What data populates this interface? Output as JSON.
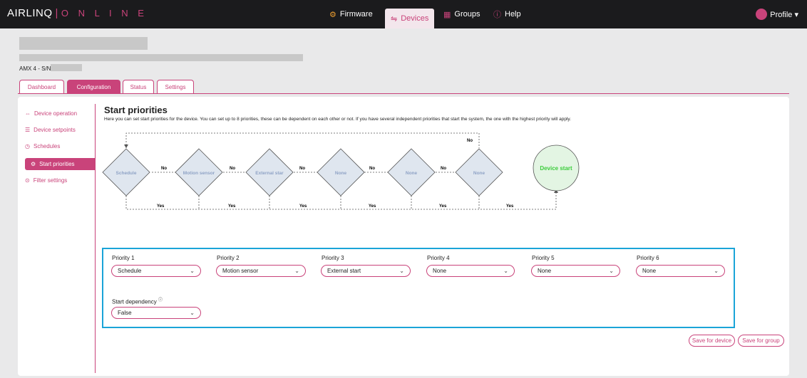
{
  "brand": {
    "name": "AIRLINQ",
    "separator": "|",
    "sub": "O N L I N E"
  },
  "nav": {
    "firmware": "Firmware",
    "devices": "Devices",
    "groups": "Groups",
    "help": "Help"
  },
  "profile": {
    "label": "Profile ▾"
  },
  "device": {
    "serial_label": "AMX 4 - S/N:"
  },
  "tabs": [
    "Dashboard",
    "Configuration",
    "Status",
    "Settings"
  ],
  "sidebar": {
    "items": [
      {
        "icon": "⇔",
        "label": "Device operation"
      },
      {
        "icon": "☰",
        "label": "Device setpoints"
      },
      {
        "icon": "◷",
        "label": "Schedules"
      },
      {
        "icon": "⚙",
        "label": "Start priorities"
      },
      {
        "icon": "⊙",
        "label": "Filter settings"
      }
    ]
  },
  "page": {
    "title": "Start priorities",
    "description": "Here you can set start priorities for the device. You can set up to 8 priorities, these can be dependent on each other or not. If you have several independent priorities that start the system, the one with the highest priority will apply."
  },
  "flow": {
    "nodes": [
      "Schedule",
      "Motion sensor",
      "External star",
      "None",
      "None",
      "None"
    ],
    "end": "Device start",
    "no": "No",
    "yes": "Yes"
  },
  "priorities": {
    "items": [
      {
        "label": "Priority 1",
        "value": "Schedule"
      },
      {
        "label": "Priority 2",
        "value": "Motion sensor"
      },
      {
        "label": "Priority 3",
        "value": "External start"
      },
      {
        "label": "Priority 4",
        "value": "None"
      },
      {
        "label": "Priority 5",
        "value": "None"
      },
      {
        "label": "Priority 6",
        "value": "None"
      }
    ],
    "dependency_label": "Start dependency",
    "dependency_value": "False"
  },
  "actions": {
    "save_device": "Save for device",
    "save_group": "Save for group"
  },
  "colors": {
    "accent": "#c9437a",
    "highlight": "#1aa4d8",
    "node_fill": "#dfe6ef",
    "start_fill": "#e3f5e3",
    "start_text": "#3ccc3c"
  }
}
